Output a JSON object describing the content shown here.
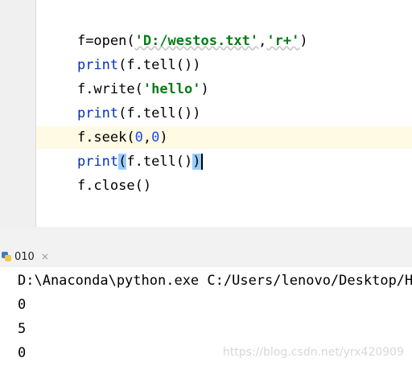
{
  "editor": {
    "lines": [
      {
        "parts": [
          [
            "plain",
            "f=open("
          ],
          [
            "str",
            "'D:/westos.txt'"
          ],
          [
            "plain",
            ","
          ],
          [
            "str",
            "'r+'"
          ],
          [
            "plain",
            ")"
          ]
        ]
      },
      {
        "parts": [
          [
            "kw",
            "print"
          ],
          [
            "plain",
            "(f.tell())"
          ]
        ]
      },
      {
        "parts": [
          [
            "plain",
            "f.write("
          ],
          [
            "str",
            "'hello'"
          ],
          [
            "plain",
            ")"
          ]
        ]
      },
      {
        "parts": [
          [
            "kw",
            "print"
          ],
          [
            "plain",
            "(f.tell())"
          ]
        ]
      },
      {
        "parts": [
          [
            "plain",
            "f.seek("
          ],
          [
            "num",
            "0"
          ],
          [
            "plain",
            ","
          ],
          [
            "num",
            "0"
          ],
          [
            "plain",
            ")"
          ]
        ]
      },
      {
        "parts": [
          [
            "kw",
            "print"
          ],
          [
            "plain",
            "(f.tell())"
          ]
        ]
      },
      {
        "parts": [
          [
            "plain",
            "f.close()"
          ]
        ]
      }
    ]
  },
  "run_tab": {
    "label": "010",
    "close": "×"
  },
  "console": {
    "lines": [
      "D:\\Anaconda\\python.exe C:/Users/lenovo/Desktop/HP",
      "0",
      "5",
      "0"
    ]
  },
  "watermark": "https://blog.csdn.net/yrx420909",
  "colors": {
    "string": "#067d17",
    "number": "#1750eb",
    "keyword": "#0033b3",
    "current_line": "#fffae3",
    "brace_match": "#99ccff"
  }
}
